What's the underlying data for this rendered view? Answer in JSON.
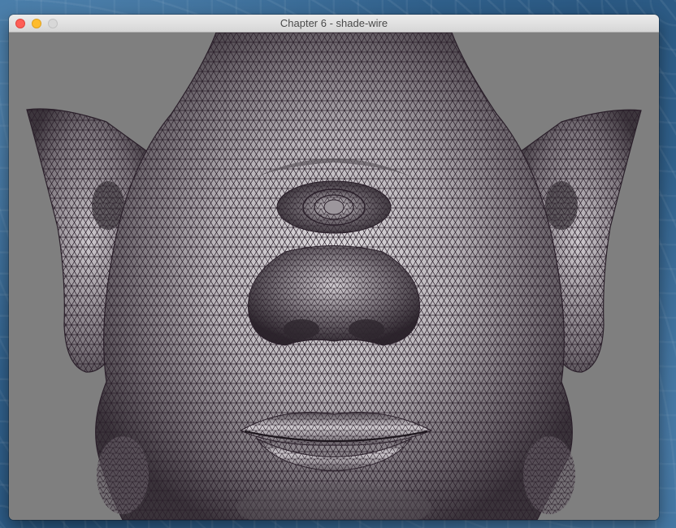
{
  "desktop": {
    "wallpaper_color": "#2d5f8a"
  },
  "window": {
    "title": "Chapter 6 - shade-wire",
    "buttons": {
      "close": "close",
      "minimize": "minimize",
      "zoom": "zoom"
    },
    "colors": {
      "close": "#fe5f57",
      "minimize": "#febc2e",
      "zoom_disabled": "#d8d8d8"
    }
  },
  "render": {
    "content": "wireframe-shaded cyclops head mesh",
    "background_color": "#7f7f7f",
    "wire_color": "#2a1f2a",
    "surface_light": "#d9d6d9",
    "surface_dark": "#4a444a"
  }
}
